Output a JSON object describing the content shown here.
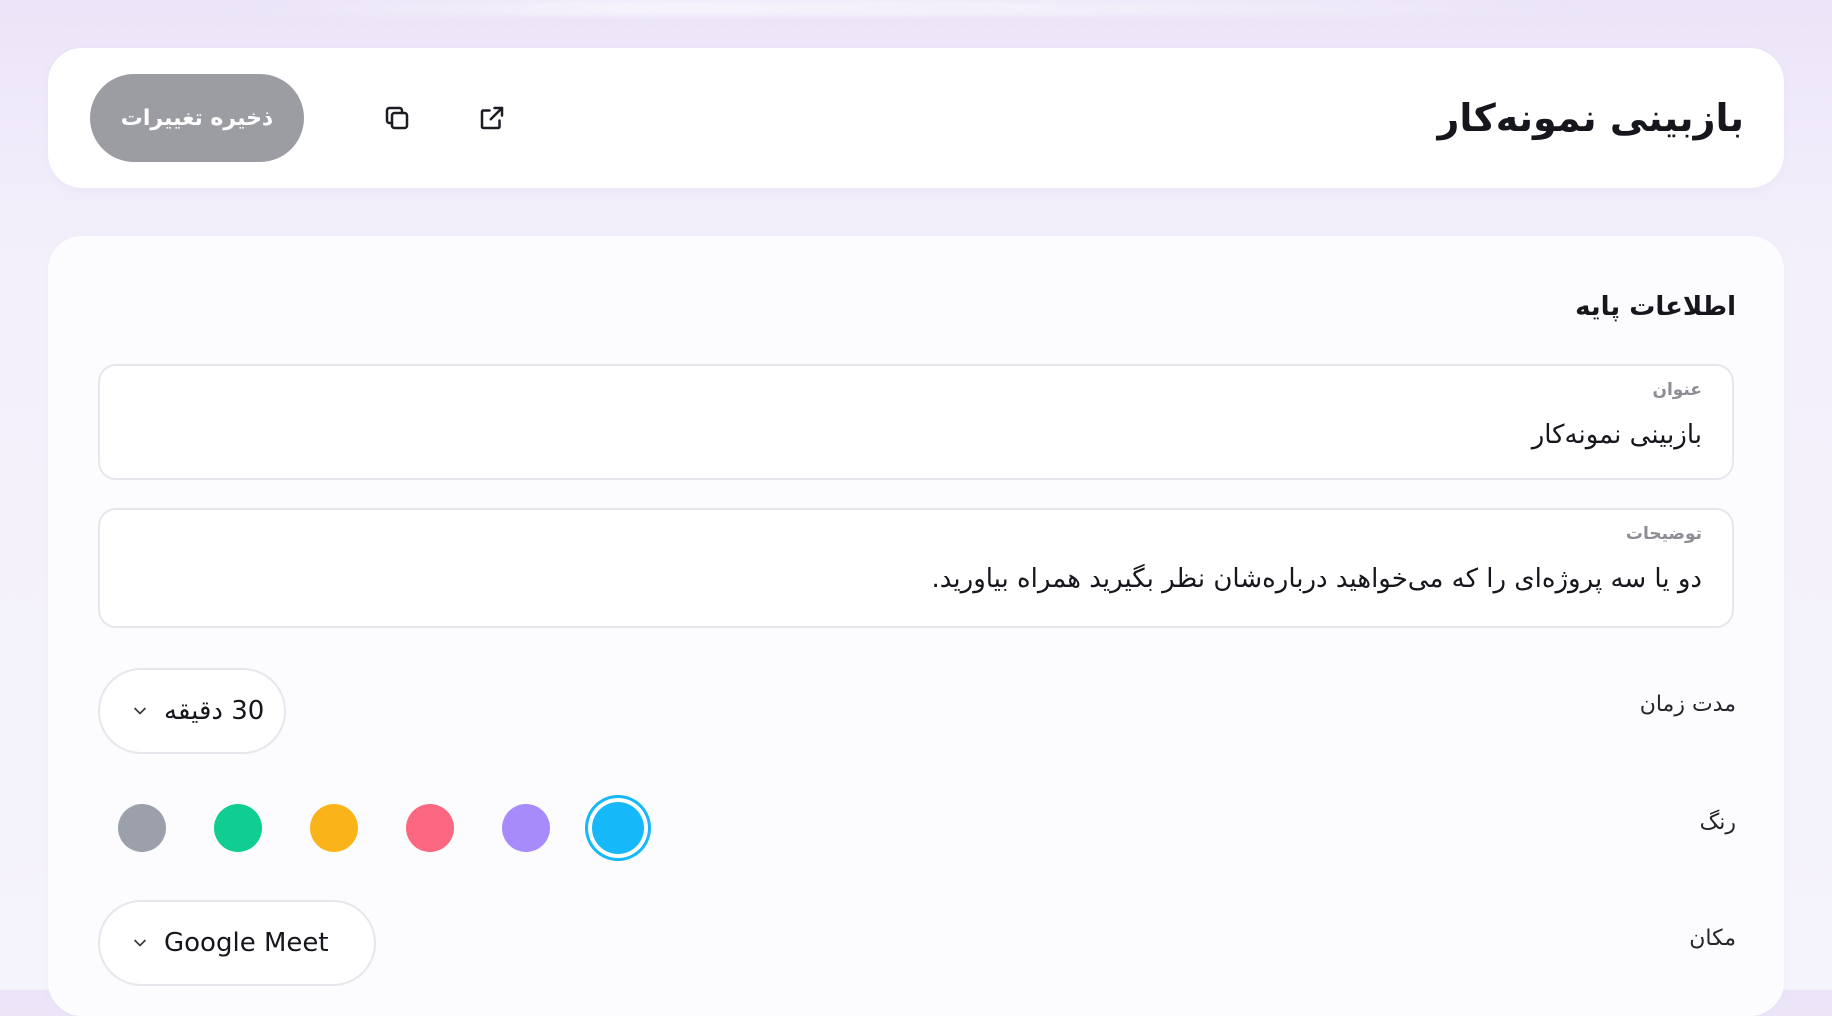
{
  "header": {
    "title": "بازبینی نمونه‌کار",
    "save_label": "ذخیره تغییرات",
    "icons": [
      "external-link-icon",
      "copy-icon"
    ]
  },
  "basic_info": {
    "section_title": "اطلاعات پایه",
    "title_field": {
      "label": "عنوان",
      "value": "بازبینی نمونه‌کار"
    },
    "description_field": {
      "label": "توضیحات",
      "value": "دو یا سه پروژه‌ای را که می‌خواهید درباره‌شان نظر بگیرید همراه بیاورید."
    },
    "duration": {
      "label": "مدت زمان",
      "value": "30 دقیقه"
    },
    "color": {
      "label": "رنگ",
      "selected": "#15b8f8",
      "options": [
        "#15b8f8",
        "#a78bfa",
        "#fb6680",
        "#fbb31a",
        "#10cd92",
        "#9ba0ab"
      ]
    },
    "location": {
      "label": "مکان",
      "value": "Google Meet"
    }
  }
}
